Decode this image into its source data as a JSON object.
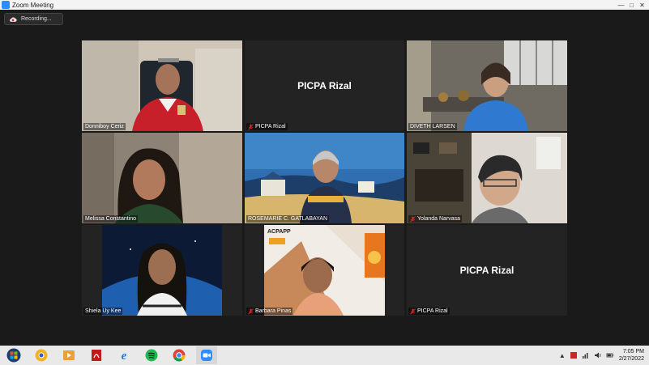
{
  "window": {
    "title": "Zoom Meeting"
  },
  "recording": {
    "label": "Recording..."
  },
  "participants": [
    {
      "name": "Donniboy Ceriz"
    },
    {
      "name": "PICPA Rizal",
      "center_label": "PICPA Rizal"
    },
    {
      "name": "DIVETH LARSEN"
    },
    {
      "name": "Melissa Constantino"
    },
    {
      "name": "ROSEMARIE C. GATLABAYAN"
    },
    {
      "name": "Yolanda Narvasa"
    },
    {
      "name": "Shiela Uy Kee"
    },
    {
      "name": "Barbara Pinas",
      "poster_text": "ACPAPP"
    },
    {
      "name": "PICPA Rizal",
      "center_label": "PICPA Rizal"
    }
  ],
  "taskbar": {
    "apps": [
      "start-icon",
      "chrome-canary-icon",
      "media-player-icon",
      "pdf-icon",
      "edge-icon",
      "spotify-icon",
      "chrome-icon",
      "zoom-icon"
    ]
  },
  "clock": {
    "time": "7:05 PM",
    "date": "2/27/2022"
  },
  "colors": {
    "active_speaker": "#d7d746",
    "zoom_blue": "#2d8cff",
    "mute_red": "#e02828"
  }
}
